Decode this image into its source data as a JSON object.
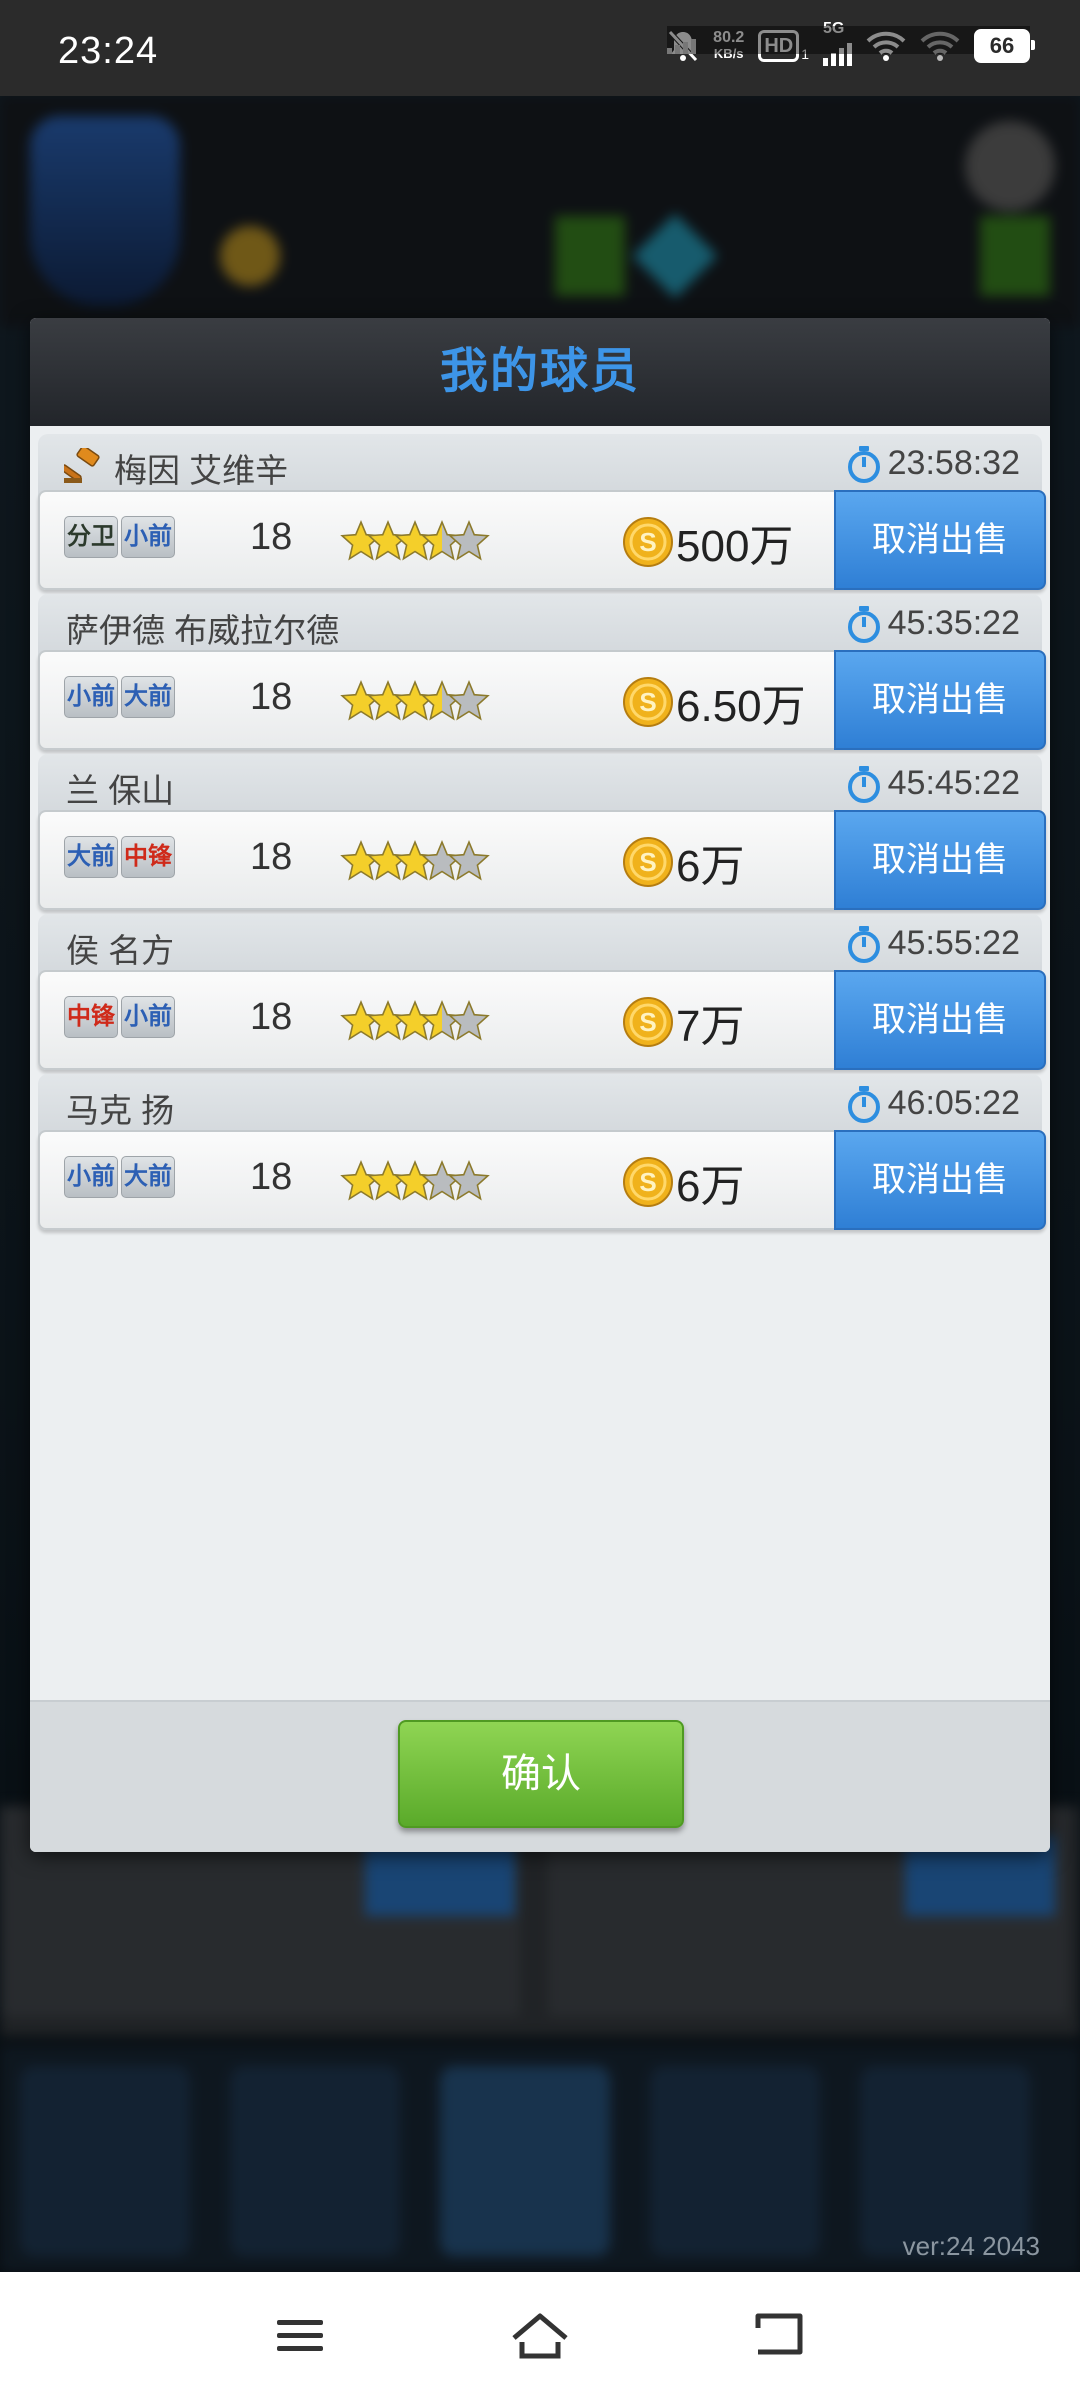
{
  "status_bar": {
    "time": "23:24",
    "net_speed_value": "80.2",
    "net_speed_unit": "KB/s",
    "hd_label": "HD",
    "hd_sub": "1",
    "network_label": "5G",
    "battery": "66"
  },
  "dialog": {
    "title": "我的球员",
    "confirm_label": "确认",
    "players": [
      {
        "name": "梅因 艾维辛",
        "auction_icon": true,
        "timer": "23:58:32",
        "positions": [
          {
            "label": "分卫",
            "color": "dark"
          },
          {
            "label": "小前",
            "color": "blue"
          }
        ],
        "age": "18",
        "stars": 3.5,
        "price": "500万",
        "cancel_label": "取消出售"
      },
      {
        "name": "萨伊德 布威拉尔德",
        "auction_icon": false,
        "timer": "45:35:22",
        "positions": [
          {
            "label": "小前",
            "color": "blue"
          },
          {
            "label": "大前",
            "color": "blue"
          }
        ],
        "age": "18",
        "stars": 3.5,
        "price": "6.50万",
        "cancel_label": "取消出售"
      },
      {
        "name": "兰 保山",
        "auction_icon": false,
        "timer": "45:45:22",
        "positions": [
          {
            "label": "大前",
            "color": "blue"
          },
          {
            "label": "中锋",
            "color": "red"
          }
        ],
        "age": "18",
        "stars": 3,
        "price": "6万",
        "cancel_label": "取消出售"
      },
      {
        "name": "侯 名方",
        "auction_icon": false,
        "timer": "45:55:22",
        "positions": [
          {
            "label": "中锋",
            "color": "red"
          },
          {
            "label": "小前",
            "color": "blue"
          }
        ],
        "age": "18",
        "stars": 3.5,
        "price": "7万",
        "cancel_label": "取消出售"
      },
      {
        "name": "马克 扬",
        "auction_icon": false,
        "timer": "46:05:22",
        "positions": [
          {
            "label": "小前",
            "color": "blue"
          },
          {
            "label": "大前",
            "color": "blue"
          }
        ],
        "age": "18",
        "stars": 3,
        "price": "6万",
        "cancel_label": "取消出售"
      }
    ]
  },
  "background": {
    "version": "ver:24  2043"
  },
  "colors": {
    "title_blue": "#3d95e8",
    "cancel_blue": "#3a8de0",
    "confirm_green": "#6fbe3a",
    "star_gold": "#f4cf2a",
    "star_gray": "#b9bcbf"
  },
  "nav": {
    "icons": [
      "menu-icon",
      "home-icon",
      "back-icon"
    ]
  }
}
